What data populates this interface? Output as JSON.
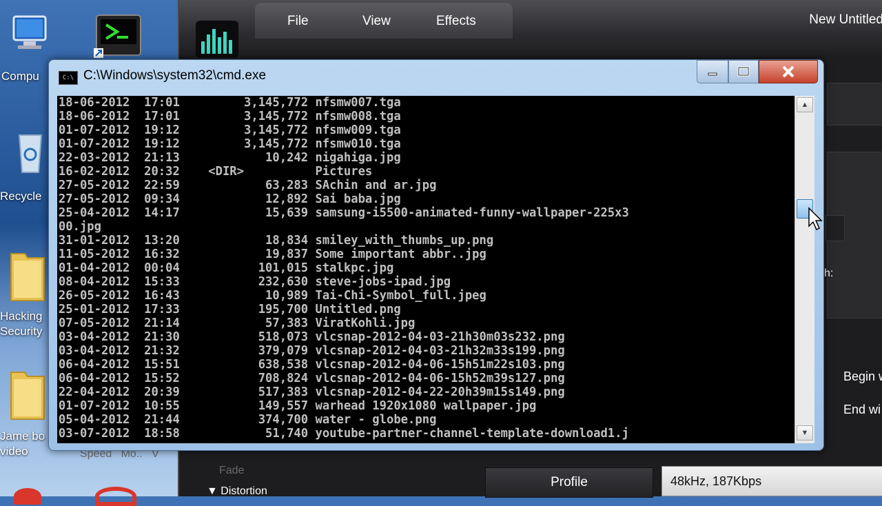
{
  "desktop": {
    "icons": [
      {
        "label": "Compu"
      },
      {
        "label": "Recycle"
      },
      {
        "label": "Hacking\nSecurity"
      },
      {
        "label": "Jame bo\nvideo"
      }
    ]
  },
  "editor": {
    "title": "New Untitled",
    "menu": [
      "File",
      "View",
      "Effects"
    ],
    "labels": {
      "begin": "Begin w",
      "end": "End wi",
      "h": "h:",
      "speed": "Speed   Mo..   V",
      "fade": "Fade",
      "distortion": "▼ Distortion"
    },
    "profile_label": "Profile",
    "rate_value": "48kHz,  187Kbps"
  },
  "cmd": {
    "title": "C:\\Windows\\system32\\cmd.exe",
    "lines": [
      "18-06-2012  17:01         3,145,772 nfsmw007.tga",
      "18-06-2012  17:01         3,145,772 nfsmw008.tga",
      "01-07-2012  19:12         3,145,772 nfsmw009.tga",
      "01-07-2012  19:12         3,145,772 nfsmw010.tga",
      "22-03-2012  21:13            10,242 nigahiga.jpg",
      "16-02-2012  20:32    <DIR>          Pictures",
      "27-05-2012  22:59            63,283 SAchin and ar.jpg",
      "27-05-2012  09:34            12,892 Sai baba.jpg",
      "25-04-2012  14:17            15,639 samsung-i5500-animated-funny-wallpaper-225x3",
      "00.jpg",
      "31-01-2012  13:20            18,834 smiley_with_thumbs_up.png",
      "11-05-2012  16:32            19,837 Some important abbr..jpg",
      "01-04-2012  00:04           101,015 stalkpc.jpg",
      "08-04-2012  15:33           232,630 steve-jobs-ipad.jpg",
      "26-05-2012  16:43            10,989 Tai-Chi-Symbol_full.jpeg",
      "25-01-2012  17:33           195,700 Untitled.png",
      "07-05-2012  21:14            57,383 ViratKohli.jpg",
      "03-04-2012  21:30           518,073 vlcsnap-2012-04-03-21h30m03s232.png",
      "03-04-2012  21:32           379,079 vlcsnap-2012-04-03-21h32m33s199.png",
      "06-04-2012  15:51           638,538 vlcsnap-2012-04-06-15h51m22s103.png",
      "06-04-2012  15:52           708,824 vlcsnap-2012-04-06-15h52m39s127.png",
      "22-04-2012  20:39           517,383 vlcsnap-2012-04-22-20h39m15s149.png",
      "01-07-2012  10:55           149,557 warhead 1920x1080 wallpaper.jpg",
      "05-04-2012  21:44           374,700 water - globe.png",
      "03-07-2012  18:58            51,740 youtube-partner-channel-template-download1.j"
    ]
  }
}
